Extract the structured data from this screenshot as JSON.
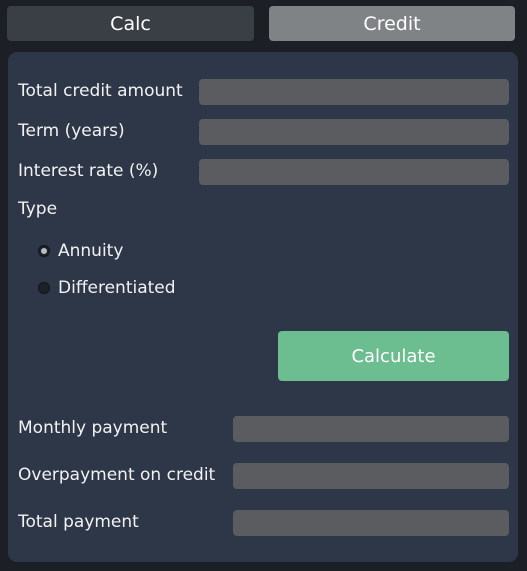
{
  "tabs": {
    "calc": "Calc",
    "credit": "Credit"
  },
  "form": {
    "total_credit_label": "Total credit amount",
    "total_credit_value": "",
    "term_label": "Term (years)",
    "term_value": "",
    "rate_label": "Interest rate (%)",
    "rate_value": "",
    "type_label": "Type",
    "type_options": [
      "Annuity",
      "Differentiated"
    ],
    "type_selected": "Annuity"
  },
  "actions": {
    "calculate_label": "Calculate"
  },
  "results": {
    "monthly_label": "Monthly payment",
    "monthly_value": "",
    "overpayment_label": "Overpayment on credit",
    "overpayment_value": "",
    "total_label": "Total payment",
    "total_value": ""
  },
  "colors": {
    "background": "#1c2026",
    "panel": "#2e3748",
    "field": "#5a5c5f",
    "active_tab": "#808386",
    "inactive_tab": "#3a3f45",
    "accent": "#6cbd8f"
  }
}
